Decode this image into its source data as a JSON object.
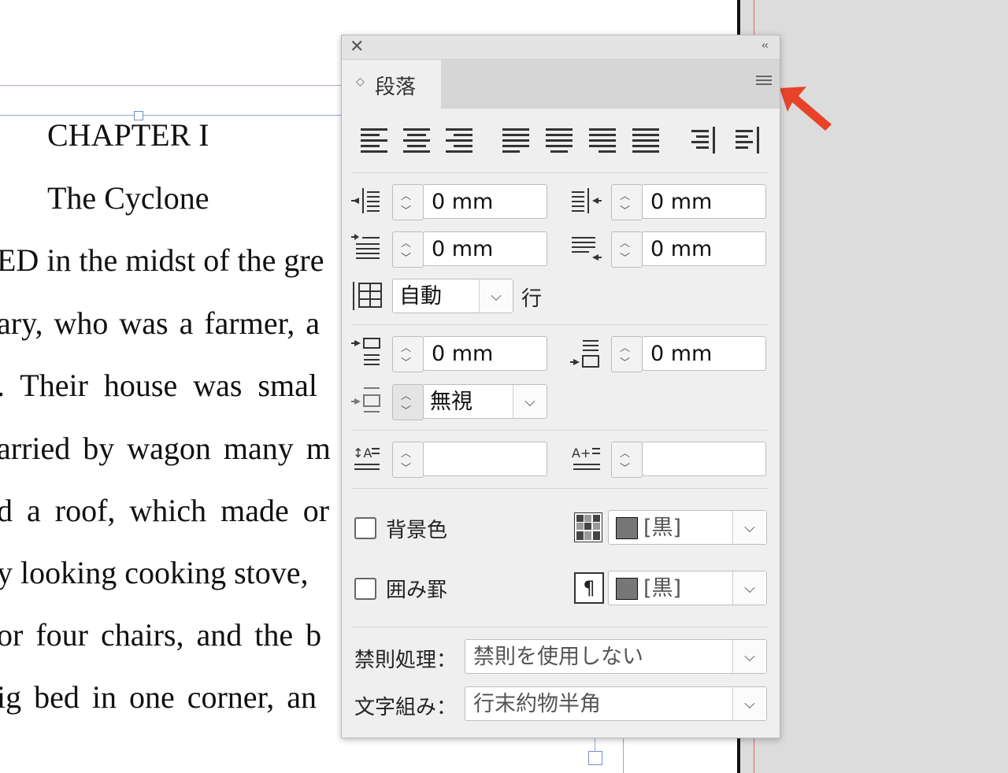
{
  "document": {
    "chapter_title": "CHAPTER I",
    "chapter_subtitle": "The Cyclone",
    "lines": [
      "ED in the midst of the gre",
      "ary, who was a farmer, a",
      ". Their house was smal",
      "arried by wagon many m",
      "d a roof, which made or",
      "y looking cooking stove,",
      "or four chairs, and the b",
      "ig bed in one corner, an"
    ]
  },
  "panel": {
    "close_icon": "close-icon",
    "collapse_label": "‹‹",
    "tab_label": "段落",
    "tab_arrows": "◇",
    "left_indent": "0 mm",
    "right_indent": "0 mm",
    "first_line_indent": "0 mm",
    "last_line_indent": "0 mm",
    "autoleading_value": "自動",
    "autoleading_unit": "行",
    "space_before": "0 mm",
    "space_after": "0 mm",
    "drop_cap_value": "無視",
    "dropcap_lines": "",
    "dropcap_chars": "",
    "background_label": "背景色",
    "background_color": "[黒]",
    "border_label": "囲み罫",
    "border_color": "[黒]",
    "kinsoku_label": "禁則処理：",
    "kinsoku_value": "禁則を使用しない",
    "mojikumi_label": "文字組み：",
    "mojikumi_value": "行末約物半角"
  },
  "colors": {
    "accent_arrow": "#e8432a",
    "swatch_fill": "#777777"
  }
}
